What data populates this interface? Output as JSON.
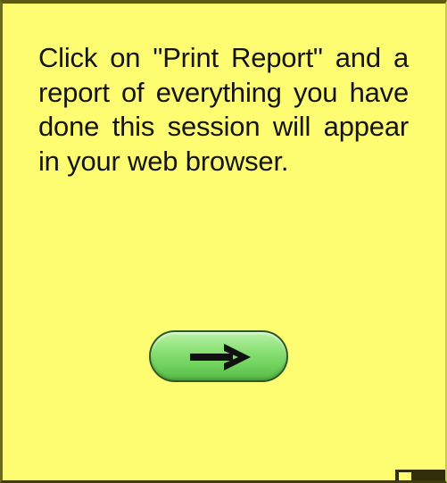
{
  "window": {
    "background_color": "#fefd72"
  },
  "message": {
    "text": "Click on \"Print Report\" and a report of everything you have done this session will appear in your web browser."
  },
  "next_button": {
    "icon": "right-arrow-icon",
    "color": "#7ddb68"
  }
}
